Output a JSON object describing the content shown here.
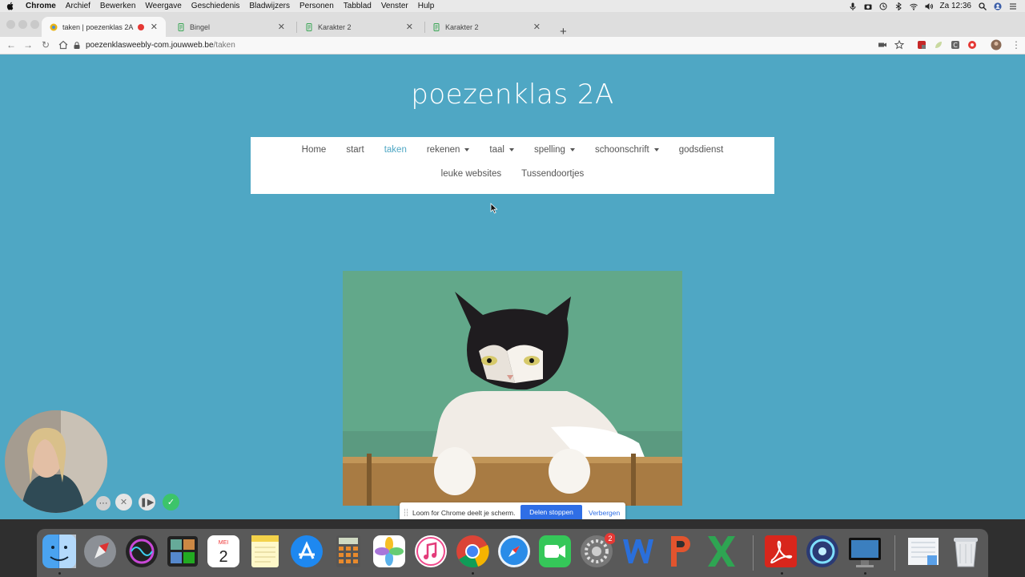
{
  "menubar": {
    "app": "Chrome",
    "items": [
      "Archief",
      "Bewerken",
      "Weergave",
      "Geschiedenis",
      "Bladwijzers",
      "Personen",
      "Tabblad",
      "Venster",
      "Hulp"
    ],
    "clock": "Za 12:36"
  },
  "tabs": [
    {
      "title": "taken | poezenklas 2A",
      "active": true,
      "recording": true
    },
    {
      "title": "Bingel",
      "active": false
    },
    {
      "title": "Karakter 2",
      "active": false
    },
    {
      "title": "Karakter 2",
      "active": false
    }
  ],
  "address": {
    "domain": "poezenklasweebly-com.jouwweb.be",
    "path": "/taken"
  },
  "site": {
    "title": "poezenklas 2A",
    "nav_row1": [
      {
        "label": "Home",
        "dropdown": false
      },
      {
        "label": "start",
        "dropdown": false
      },
      {
        "label": "taken",
        "dropdown": false,
        "active": true
      },
      {
        "label": "rekenen",
        "dropdown": true
      },
      {
        "label": "taal",
        "dropdown": true
      },
      {
        "label": "spelling",
        "dropdown": true
      },
      {
        "label": "schoonschrift",
        "dropdown": true
      },
      {
        "label": "godsdienst",
        "dropdown": false
      }
    ],
    "nav_row2": [
      {
        "label": "leuke websites",
        "dropdown": false
      },
      {
        "label": "Tussendoortjes",
        "dropdown": false
      }
    ],
    "background_color": "#4fa7c4"
  },
  "loom": {
    "message": "Loom for Chrome deelt je scherm.",
    "stop_label": "Delen stoppen",
    "hide_label": "Verbergen"
  },
  "dock": {
    "calendar_month": "MEI",
    "calendar_day": "2",
    "settings_badge": "2",
    "apps": [
      "finder-icon",
      "launchpad-icon",
      "siri-icon",
      "photo-booth-icon",
      "calendar-icon",
      "notes-icon",
      "app-store-icon",
      "calculator-icon",
      "photos-icon",
      "itunes-icon",
      "chrome-icon",
      "safari-icon",
      "facetime-icon",
      "system-preferences-icon",
      "word-icon",
      "powerpoint-icon",
      "excel-icon",
      "acrobat-icon",
      "music-app-icon",
      "screenflow-icon",
      "downloads-icon",
      "trash-icon"
    ]
  }
}
